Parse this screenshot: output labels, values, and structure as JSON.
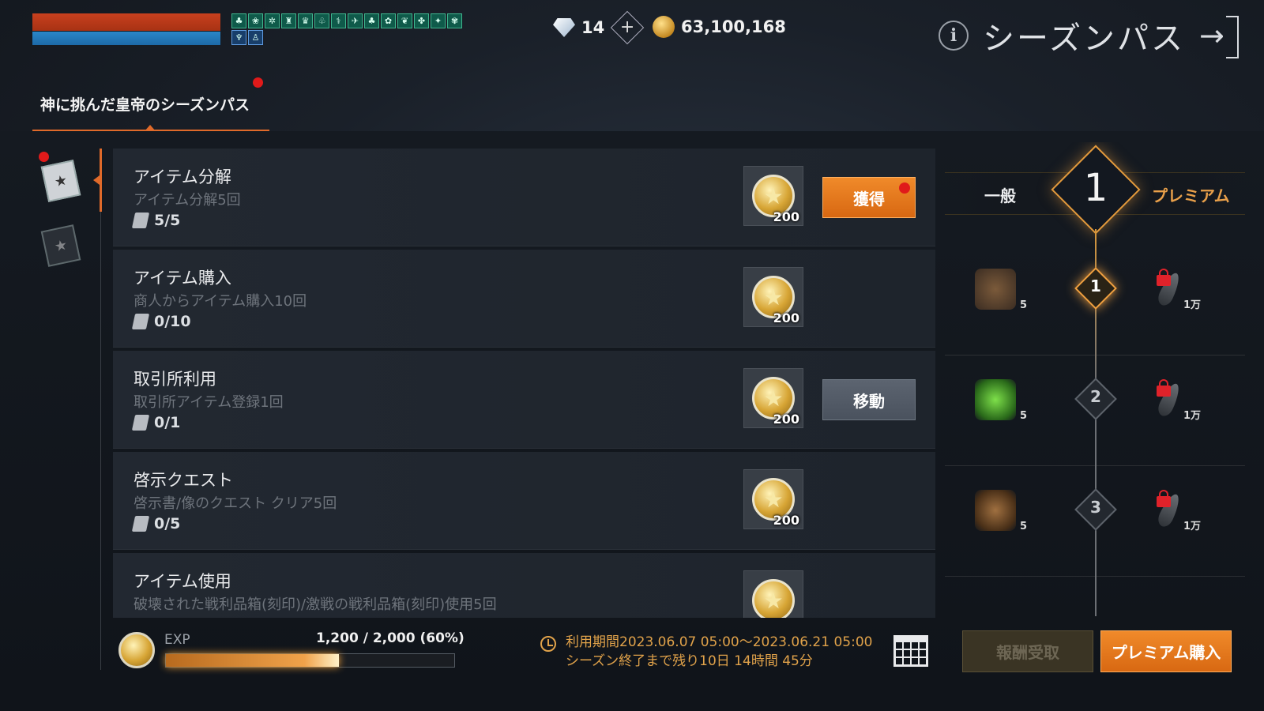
{
  "header": {
    "buffs_row1": [
      "♣",
      "❀",
      "✲",
      "♜",
      "♛",
      "♧",
      "⚕",
      "✈",
      "♣",
      "✿",
      "❦",
      "✤",
      "✦",
      "✾"
    ],
    "buffs_row2": [
      "♆",
      "♙"
    ],
    "diamond_count": "14",
    "gold_count": "63,100,168",
    "title": "シーズンパス"
  },
  "tab": {
    "label": "神に挑んだ皇帝のシーズンパス"
  },
  "quests": [
    {
      "title": "アイテム分解",
      "desc": "アイテム分解5回",
      "progress": "5/5",
      "reward_amount": "200",
      "action": "獲得"
    },
    {
      "title": "アイテム購入",
      "desc": "商人からアイテム購入10回",
      "progress": "0/10",
      "reward_amount": "200",
      "action": ""
    },
    {
      "title": "取引所利用",
      "desc": "取引所アイテム登録1回",
      "progress": "0/1",
      "reward_amount": "200",
      "action": "移動"
    },
    {
      "title": "啓示クエスト",
      "desc": "啓示書/像のクエスト クリア5回",
      "progress": "0/5",
      "reward_amount": "200",
      "action": ""
    },
    {
      "title": "アイテム使用",
      "desc": "破壊された戦利品箱(刻印)/激戦の戦利品箱(刻印)使用5回",
      "progress": "",
      "reward_amount": "",
      "action": ""
    }
  ],
  "exp": {
    "label": "EXP",
    "value": "1,200 / 2,000 (60%)",
    "fraction": 0.6
  },
  "period": {
    "line1": "利用期間2023.06.07 05:00～2023.06.21 05:00",
    "line2": "シーズン終了まで残り10日 14時間 45分"
  },
  "pass": {
    "normal_label": "一般",
    "premium_label": "プレミアム",
    "current_level": "1",
    "levels": [
      {
        "num": "1",
        "normal_qty": "5",
        "premium_qty": "1万"
      },
      {
        "num": "2",
        "normal_qty": "5",
        "premium_qty": "1万"
      },
      {
        "num": "3",
        "normal_qty": "5",
        "premium_qty": "1万"
      }
    ]
  },
  "buttons": {
    "receive_rewards": "報酬受取",
    "buy_premium": "プレミアム購入"
  }
}
